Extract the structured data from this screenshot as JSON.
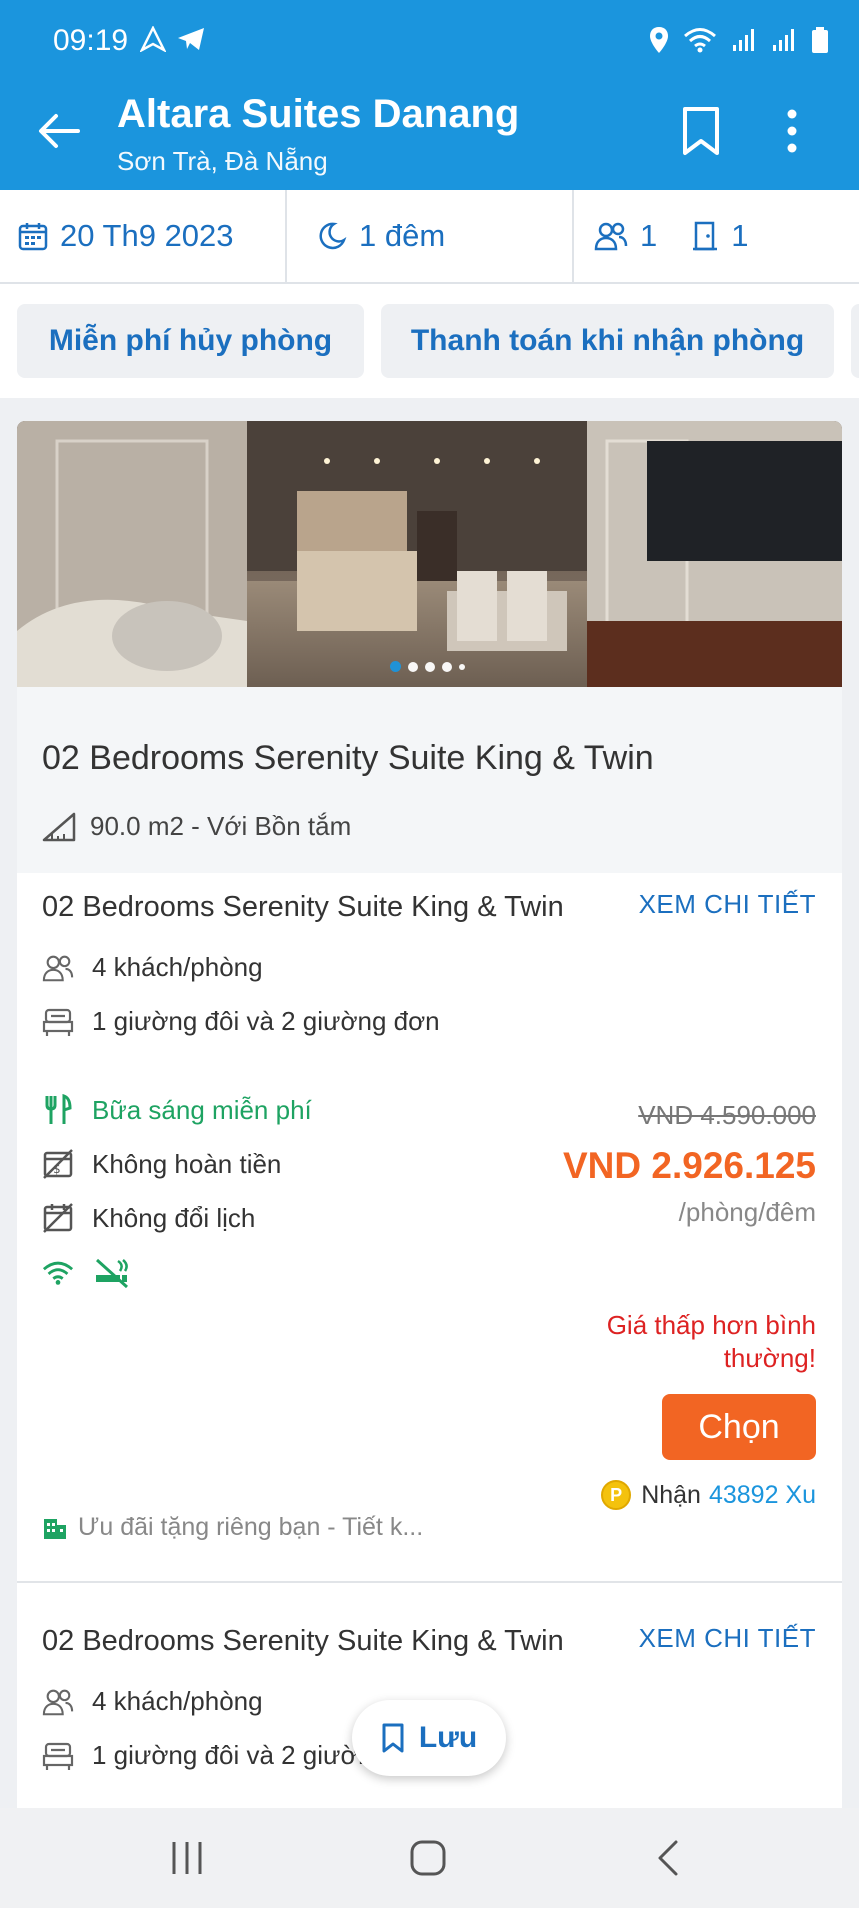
{
  "status_bar": {
    "time": "09:19"
  },
  "header": {
    "title": "Altara Suites Danang",
    "subtitle": "Sơn Trà, Đà Nẵng"
  },
  "search": {
    "date": "20 Th9 2023",
    "nights": "1 đêm",
    "guests": "1",
    "rooms": "1"
  },
  "filters": [
    {
      "label": "Miễn phí hủy phòng"
    },
    {
      "label": "Thanh toán khi nhận phòng"
    }
  ],
  "room": {
    "photo_dots": 5,
    "active_dot": 1,
    "name": "02 Bedrooms Serenity Suite King & Twin",
    "size": "90.0 m2 - Với Bồn tắm"
  },
  "rates": [
    {
      "name": "02 Bedrooms Serenity Suite King & Twin",
      "details_label": "XEM CHI TIẾT",
      "guests": "4 khách/phòng",
      "beds": "1 giường đôi và 2 giường đơn",
      "breakfast": "Bữa sáng miễn phí",
      "refund": "Không hoàn tiền",
      "reschedule": "Không đổi lịch",
      "old_price": "VND  4.590.000",
      "price": "VND  2.926.125",
      "per_unit": "/phòng/đêm",
      "deal_text": "Giá thấp hơn bình thường!",
      "choose_label": "Chọn",
      "points_prefix": "Nhận",
      "points_value": "43892 Xu",
      "promo": "Ưu đãi tặng riêng bạn - Tiết k..."
    },
    {
      "name": "02 Bedrooms Serenity Suite King & Twin",
      "details_label": "XEM CHI TIẾT",
      "guests": "4 khách/phòng",
      "beds": "1 giường đôi và 2 giườ..."
    }
  ],
  "fab": {
    "label": "Lưu"
  },
  "colors": {
    "brand_blue": "#1b95dd",
    "link_blue": "#1b6fbf",
    "price_orange": "#f26523",
    "green": "#1ea362",
    "deal_red": "#dd2222"
  }
}
